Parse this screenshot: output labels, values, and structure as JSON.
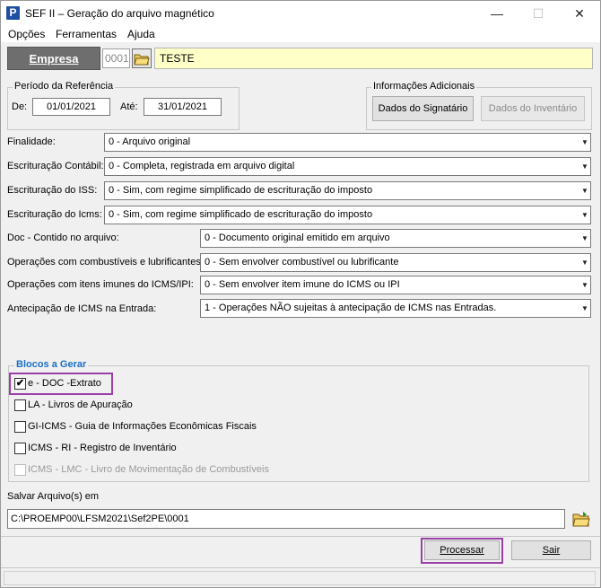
{
  "window": {
    "title": "SEF II – Geração do arquivo magnético",
    "app_icon_letter": "P",
    "controls": {
      "minimize": "—",
      "maximize": "☐",
      "close": "✕"
    }
  },
  "menu": {
    "items": [
      "Opções",
      "Ferramentas",
      "Ajuda"
    ]
  },
  "empresa": {
    "label": "Empresa",
    "code": "0001",
    "name": "TESTE"
  },
  "periodo": {
    "legend": "Período da Referência",
    "de_label": "De:",
    "de_value": "01/01/2021",
    "ate_label": "Até:",
    "ate_value": "31/01/2021"
  },
  "info_adicionais": {
    "legend": "Informações Adicionais",
    "signatario_button": "Dados do Signatário",
    "inventario_button": "Dados do Inventário"
  },
  "fields": [
    {
      "label": "Finalidade:",
      "value": "0 - Arquivo original"
    },
    {
      "label": "Escrituração Contábil:",
      "value": "0 - Completa, registrada em arquivo digital"
    },
    {
      "label": "Escrituração do ISS:",
      "value": "0 - Sim, com regime simplificado de escrituração do imposto"
    },
    {
      "label": "Escrituração do Icms:",
      "value": "0 - Sim, com regime simplificado de escrituração do imposto"
    },
    {
      "label": "Doc - Contido no arquivo:",
      "value": "0 - Documento original emitido em arquivo"
    },
    {
      "label": "Operações com combustíveis e lubrificantes:",
      "value": "0 - Sem envolver combustível ou lubrificante"
    },
    {
      "label": "Operações com itens imunes do ICMS/IPI:",
      "value": "0 - Sem envolver item imune do ICMS ou IPI"
    },
    {
      "label": "Antecipação de ICMS na Entrada:",
      "value": "1 - Operações NÃO sujeitas à antecipação de ICMS nas Entradas."
    }
  ],
  "blocos": {
    "legend": "Blocos a Gerar",
    "items": [
      {
        "label": "e - DOC  -Extrato",
        "checked": true,
        "enabled": true
      },
      {
        "label": "LA - Livros de Apuração",
        "checked": false,
        "enabled": true
      },
      {
        "label": "GI-ICMS - Guia de Informações Econômicas Fiscais",
        "checked": false,
        "enabled": true
      },
      {
        "label": "ICMS - RI - Registro de Inventário",
        "checked": false,
        "enabled": true
      },
      {
        "label": "ICMS - LMC - Livro de Movimentação de Combustíveis",
        "checked": false,
        "enabled": false
      }
    ]
  },
  "salvar": {
    "label": "Salvar Arquivo(s) em",
    "path": "C:\\PROEMP00\\LFSM2021\\Sef2PE\\0001"
  },
  "actions": {
    "processar": "Processar",
    "sair": "Sair"
  },
  "colors": {
    "highlight": "#9b3fa8",
    "legend_blue": "#1a6fc8",
    "empresa_bg": "#ffffc8"
  }
}
